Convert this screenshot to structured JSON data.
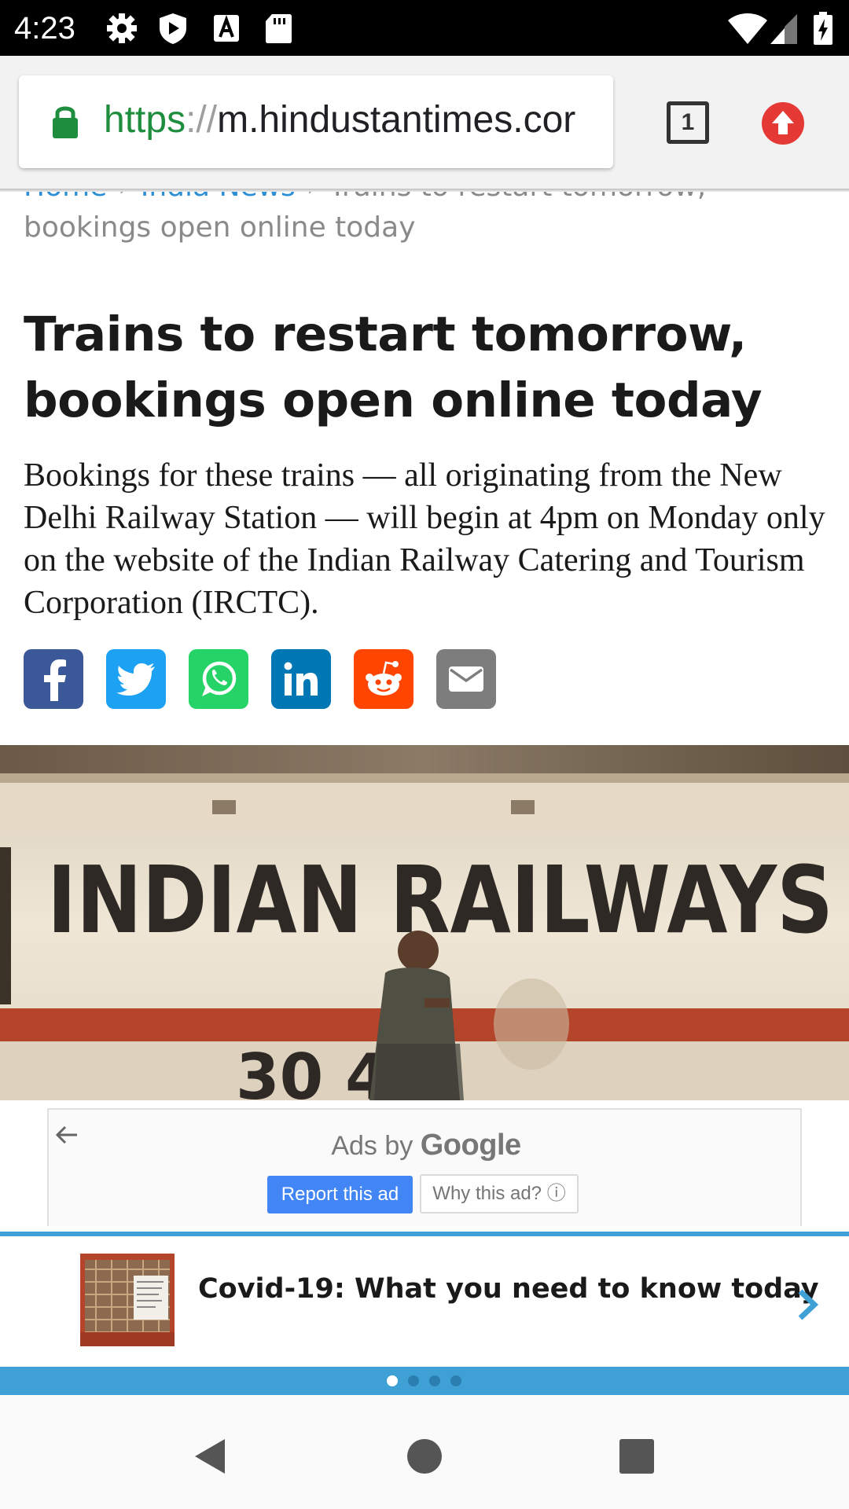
{
  "status_bar": {
    "time": "4:23",
    "left_icons": [
      "gear-icon",
      "shield-icon",
      "a-icon",
      "sd-card-icon"
    ],
    "right_icons": [
      "wifi-icon",
      "cell-signal-icon",
      "battery-charging-icon"
    ]
  },
  "browser": {
    "url_scheme": "https",
    "url_separator": "://",
    "url_host": "m.hindustantimes.cor",
    "tab_count": "1",
    "secure_color": "#1e8e3e",
    "update_color": "#e53935"
  },
  "breadcrumb": {
    "home": "Home",
    "section": "India News",
    "current_line1": "Trains to restart tomorrow,",
    "current_line2": "bookings open online today"
  },
  "article": {
    "headline": "Trains to restart tomorrow, bookings open online today",
    "summary": "Bookings for these trains — all originating from the New Delhi Railway Station — will begin at 4pm on Monday only on the website of the Indian Railway Catering and Tourism Corporation (IRCTC)."
  },
  "share": {
    "buttons": [
      {
        "name": "facebook",
        "color": "#3b5998"
      },
      {
        "name": "twitter",
        "color": "#1da1f2"
      },
      {
        "name": "whatsapp",
        "color": "#25d366"
      },
      {
        "name": "linkedin",
        "color": "#0077b5"
      },
      {
        "name": "reddit",
        "color": "#ff4500"
      },
      {
        "name": "email",
        "color": "#7d7d7d"
      }
    ]
  },
  "photo": {
    "sign_text": "INDIAN RAILWAYS",
    "number_text": "30  4"
  },
  "ad": {
    "ads_by": "Ads by",
    "google": "Google",
    "report_label": "Report this ad",
    "why_label": "Why this ad? ⓘ"
  },
  "covid_card": {
    "title": "Covid-19: What you need to know today",
    "accent_color": "#3fa0d6",
    "dots": 4,
    "active_dot": 0
  },
  "nav": {
    "back": "back-icon",
    "home": "home-icon",
    "recents": "recents-icon"
  }
}
